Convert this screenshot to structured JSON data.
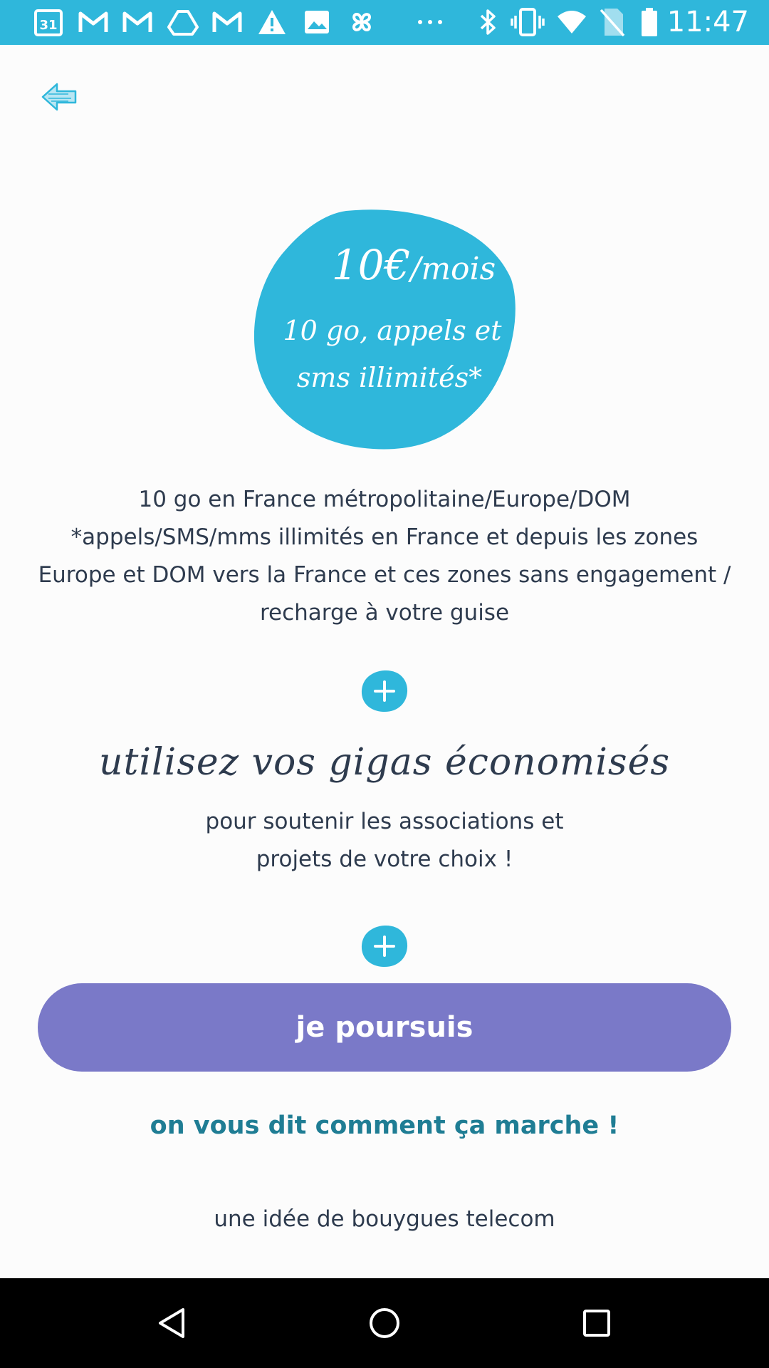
{
  "status_bar": {
    "time": "11:47",
    "icons": [
      "calendar-icon",
      "gmail-icon",
      "gmail-icon",
      "drive-icon",
      "gmail-icon",
      "warning-icon",
      "photos-icon",
      "pinwheel-icon",
      "more-icon",
      "bluetooth-icon",
      "vibrate-icon",
      "wifi-icon",
      "no-sim-icon",
      "battery-icon"
    ],
    "calendar_day": "31",
    "background": "#2fb7db"
  },
  "header": {
    "back_icon": "back-arrow-icon"
  },
  "offer": {
    "price": "10€",
    "price_unit": "/mois",
    "line2": "10 go, appels et",
    "line3": "sms illimités*",
    "blob_color": "#2fb7db"
  },
  "description": {
    "line1": "10 go en France métropolitaine/Europe/DOM",
    "line2": "*appels/SMS/mms illimités en France et depuis les zones",
    "line3": "Europe et DOM vers la France et ces zones sans engagement /",
    "line4": "recharge à votre guise"
  },
  "giga": {
    "headline": "utilisez vos gigas économisés",
    "sub1": "pour soutenir les associations et",
    "sub2": "projets de votre choix !"
  },
  "actions": {
    "continue_label": "je poursuis",
    "how_label": "on vous dit comment ça marche !",
    "button_color": "#7a79c8",
    "link_color": "#1f7d94"
  },
  "footer": {
    "text": "une idée de bouygues telecom"
  },
  "nav": {
    "back": "nav-back-icon",
    "home": "nav-home-icon",
    "recents": "nav-recents-icon"
  }
}
